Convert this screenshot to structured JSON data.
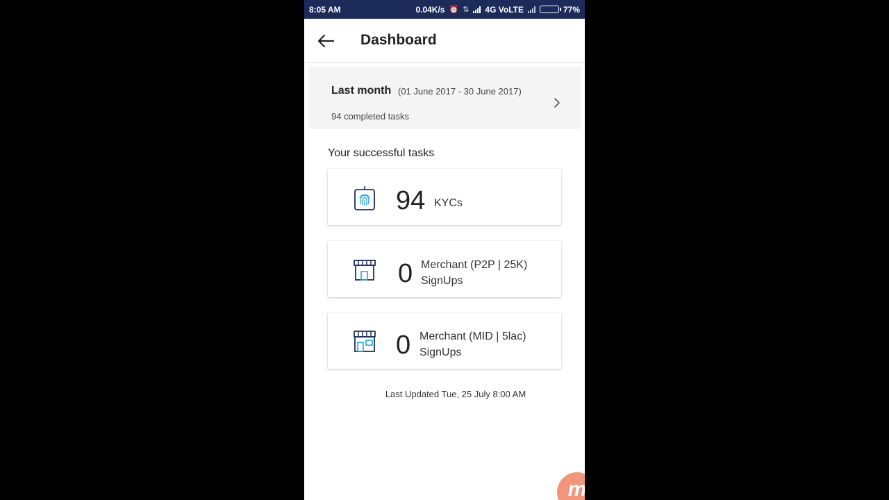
{
  "status_bar": {
    "time": "8:05 AM",
    "speed": "0.04K/s",
    "network": "4G VoLTE",
    "battery": "77%",
    "battery_level": 0.77
  },
  "header": {
    "title": "Dashboard",
    "back_icon": "arrow-left-icon"
  },
  "period": {
    "title": "Last month",
    "range": "(01 June 2017 - 30 June 2017)",
    "summary": "94 completed tasks",
    "chevron_icon": "chevron-right-icon"
  },
  "tasks": {
    "section_title": "Your successful tasks",
    "items": [
      {
        "icon": "fingerprint-device-icon",
        "count": "94",
        "label_line1": "KYCs",
        "label_line2": ""
      },
      {
        "icon": "storefront-icon",
        "count": "0",
        "label_line1": "Merchant (P2P | 25K)",
        "label_line2": "SignUps"
      },
      {
        "icon": "storefront-large-icon",
        "count": "0",
        "label_line1": "Merchant (MID | 5lac)",
        "label_line2": "SignUps"
      }
    ]
  },
  "footer": {
    "last_updated": "Last Updated Tue, 25 July 8:00 AM"
  },
  "colors": {
    "status_bar": "#1d2b5a",
    "icon_navy": "#1e2f5e",
    "icon_cyan": "#22a7d9",
    "card_bg": "#f4f4f4"
  }
}
